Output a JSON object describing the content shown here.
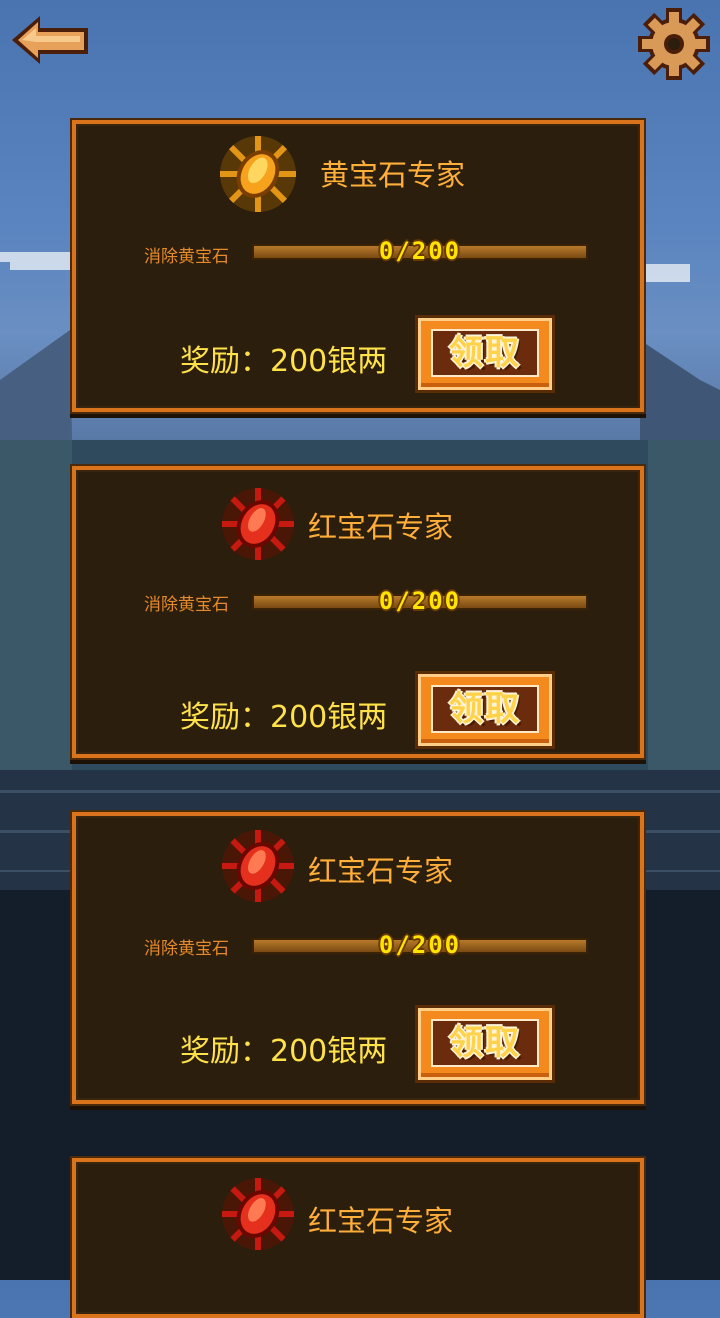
{
  "colors": {
    "card_border": "#d9741d",
    "card_bg": "#2b1e0c",
    "title": "#ffae3a",
    "reward": "#ffe14a",
    "progress_text": "#ffe400"
  },
  "toolbar": {
    "back_icon": "arrow-left-icon",
    "settings_icon": "gear-icon"
  },
  "achievements": [
    {
      "gem": "topaz-icon",
      "gem_color": "#f6a21c",
      "title": "黄宝石专家",
      "task": "消除黄宝石",
      "progress_text": "0/200",
      "progress": 0.0,
      "reward": "奖励：200银两",
      "claim_label": "领取"
    },
    {
      "gem": "ruby-icon",
      "gem_color": "#e4301c",
      "title": "红宝石专家",
      "task": "消除黄宝石",
      "progress_text": "0/200",
      "progress": 0.0,
      "reward": "奖励：200银两",
      "claim_label": "领取"
    },
    {
      "gem": "ruby-icon",
      "gem_color": "#e4301c",
      "title": "红宝石专家",
      "task": "消除黄宝石",
      "progress_text": "0/200",
      "progress": 0.0,
      "reward": "奖励：200银两",
      "claim_label": "领取"
    },
    {
      "gem": "ruby-icon",
      "gem_color": "#e4301c",
      "title": "红宝石专家"
    }
  ]
}
